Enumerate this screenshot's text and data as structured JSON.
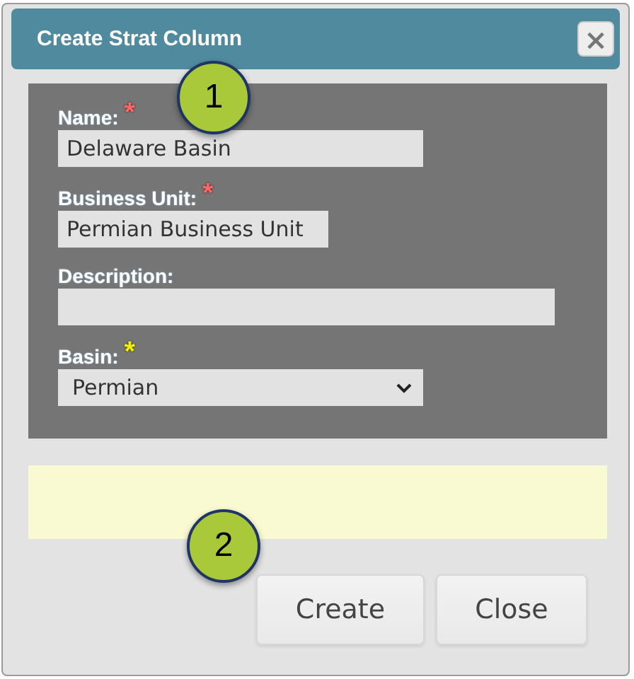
{
  "dialog": {
    "title": "Create Strat Column",
    "close_icon": "×"
  },
  "fields": [
    {
      "kind": "text",
      "label": "Name:",
      "required_mark": "*",
      "color": "#ff6666",
      "value": "Delaware Basin"
    },
    {
      "kind": "text",
      "label": "Business Unit:",
      "required_mark": "*",
      "color": "#ff6666",
      "value": "Permian Business Unit"
    },
    {
      "kind": "text",
      "label": "Description:"
    },
    {
      "kind": "select",
      "label": "Basin:",
      "required_mark": "*",
      "color": "#f0f000",
      "value": "Permian"
    }
  ],
  "callouts": [
    "1",
    "2"
  ],
  "buttons": [
    "Create",
    "Close"
  ]
}
